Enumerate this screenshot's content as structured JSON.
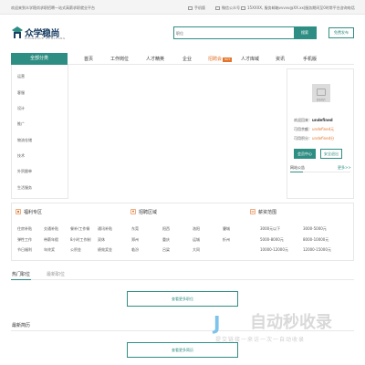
{
  "topbar": {
    "welcome": "欢迎来到众学稳尚求职招聘—站式高薪求职就业平台",
    "mobile": "手机版",
    "wechat": "微信公众号",
    "contact": "15XXXX, 服务邮箱vvvvv@XX.xx|服务期间至0时常平台咨询电话"
  },
  "logo": {
    "name": "众学稳尚",
    "sub": "ZHONGXUE WENSHANG"
  },
  "search": {
    "scope": "职位",
    "placeholder": "",
    "button": "搜索",
    "publish": "免费发布"
  },
  "nav": {
    "all": "全部分类",
    "items": [
      "首页",
      "工作岗位",
      "人才精英",
      "企业",
      "招聘会",
      "人才库域",
      "资讯",
      "手机版"
    ],
    "hot_badge": "HOT"
  },
  "categories": [
    "运营",
    "客服",
    "设计",
    "推广",
    "物流仓储",
    "技术",
    "外贸跟单",
    "生活服务"
  ],
  "login": {
    "avatar_caption": "暂无相片",
    "welcome_label": "欢迎回来：",
    "welcome_value": "undefined",
    "balance_label": "可用余额：",
    "balance_value": "undefined元",
    "points_label": "可用积分：",
    "points_value": "undefined分",
    "center_btn": "会员中心",
    "logout_btn": "安全退出",
    "notice_tab": "网站公告",
    "notice_more": "更多>>"
  },
  "modules": {
    "welfare": {
      "title": "福利专区",
      "items": [
        "住房补贴",
        "交通补贴",
        "餐补/工作餐",
        "通讯补贴",
        "弹性工作",
        "带薪年假",
        "8小时工作制",
        "双休",
        "节日福利",
        "年终奖",
        "公积金",
        "绩效奖金"
      ]
    },
    "region": {
      "title": "招聘区域",
      "items": [
        "东莞",
        "阳西",
        "洛阳",
        "肇城",
        "郑州",
        "重庆",
        "运城",
        "忻州",
        "临汾",
        "吕梁",
        "大同"
      ]
    },
    "salary": {
      "title": "薪资范围",
      "items": [
        "3000元以下",
        "3000-5000元",
        "5000-8000元",
        "8000-10000元",
        "10000-12000元",
        "12000-15000元"
      ]
    }
  },
  "jobs": {
    "tab_active": "热门职位",
    "tab_other": "最新职位",
    "more": "查看更多职位"
  },
  "resumes": {
    "title": "最新简历",
    "more": "查看更多简历"
  },
  "watermark": {
    "brand": "自动秒收录",
    "slogan": "提交链接一来访一次一自动收录"
  },
  "colors": {
    "accent": "#2f8e83",
    "orange": "#e4742b",
    "logo": "#1a3f63"
  }
}
